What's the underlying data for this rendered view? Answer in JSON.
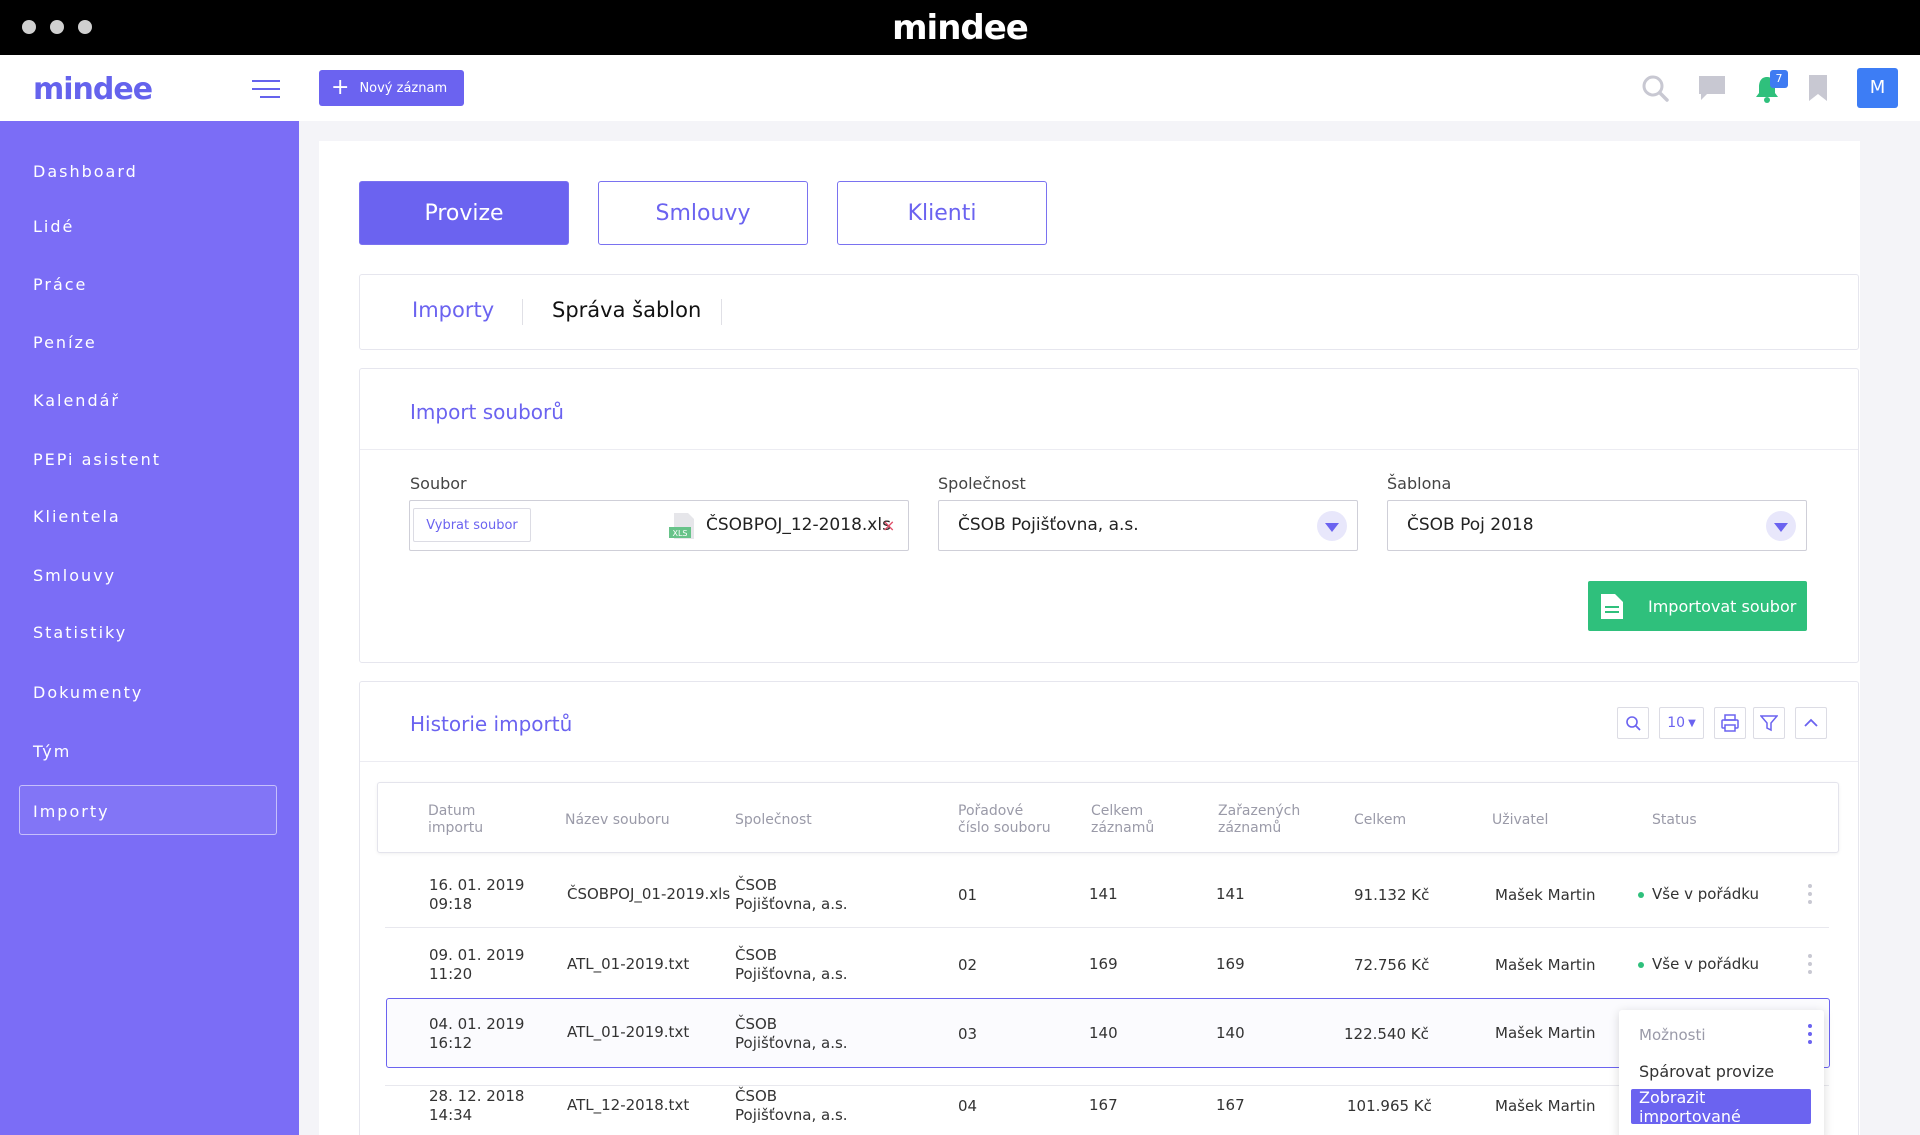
{
  "window": {
    "title": "mindee"
  },
  "sidebar": {
    "logo": "mindee",
    "items": [
      {
        "label": "Dashboard"
      },
      {
        "label": "Lidé"
      },
      {
        "label": "Práce"
      },
      {
        "label": "Peníze"
      },
      {
        "label": "Kalendář"
      },
      {
        "label": "PEPi asistent"
      },
      {
        "label": "Klientela"
      },
      {
        "label": "Smlouvy"
      },
      {
        "label": "Statistiky"
      },
      {
        "label": "Dokumenty"
      },
      {
        "label": "Tým"
      },
      {
        "label": "Importy"
      }
    ],
    "active": "Importy"
  },
  "topbar": {
    "new_button": "Nový záznam",
    "notification_count": "7",
    "avatar_initial": "M"
  },
  "main_tabs": [
    {
      "label": "Provize",
      "active": true
    },
    {
      "label": "Smlouvy",
      "active": false
    },
    {
      "label": "Klienti",
      "active": false
    }
  ],
  "sub_tabs": [
    {
      "label": "Importy",
      "active": true
    },
    {
      "label": "Správa šablon",
      "active": false
    }
  ],
  "import": {
    "title": "Import souborů",
    "file_label": "Soubor",
    "pick_button": "Vybrat soubor",
    "file_name": "ČSOBPOJ_12-2018.xls",
    "file_icon_label": "XLS",
    "remove": "×",
    "company_label": "Společnost",
    "company_value": "ČSOB Pojišťovna, a.s.",
    "template_label": "Šablona",
    "template_value": "ČSOB Poj 2018",
    "import_button": "Importovat soubor"
  },
  "history": {
    "title": "Historie importů",
    "page_size": "10",
    "columns": [
      [
        "Datum",
        "importu"
      ],
      [
        "Název souboru",
        ""
      ],
      [
        "Společnost",
        ""
      ],
      [
        "Pořadové",
        "číslo souboru"
      ],
      [
        "Celkem",
        "záznamů"
      ],
      [
        "Zařazených",
        "záznamů"
      ],
      [
        "Celkem",
        ""
      ],
      [
        "Uživatel",
        ""
      ],
      [
        "Status",
        ""
      ]
    ],
    "rows": [
      {
        "date": "16. 01. 2019",
        "time": "09:18",
        "file": "ČSOBPOJ_01-2019.xls",
        "company1": "ČSOB",
        "company2": "Pojišťovna, a.s.",
        "order": "01",
        "total": "141",
        "assigned": "141",
        "amount": "91.132 Kč",
        "user": "Mašek Martin",
        "status": "Vše v pořádku"
      },
      {
        "date": "09. 01. 2019",
        "time": "11:20",
        "file": "ATL_01-2019.txt",
        "company1": "ČSOB",
        "company2": "Pojišťovna, a.s.",
        "order": "02",
        "total": "169",
        "assigned": "169",
        "amount": "72.756 Kč",
        "user": "Mašek Martin",
        "status": "Vše v pořádku"
      },
      {
        "date": "04. 01. 2019",
        "time": "16:12",
        "file": "ATL_01-2019.txt",
        "company1": "ČSOB",
        "company2": "Pojišťovna, a.s.",
        "order": "03",
        "total": "140",
        "assigned": "140",
        "amount": "122.540 Kč",
        "user": "Mašek Martin",
        "status": ""
      },
      {
        "date": "28. 12. 2018",
        "time": "14:34",
        "file": "ATL_12-2018.txt",
        "company1": "ČSOB",
        "company2": "Pojišťovna, a.s.",
        "order": "04",
        "total": "167",
        "assigned": "167",
        "amount": "101.965 Kč",
        "user": "Mašek Martin",
        "status": ""
      }
    ],
    "menu": {
      "title": "Možnosti",
      "items": [
        "Spárovat provize",
        "Zobrazit importované"
      ]
    }
  },
  "colors": {
    "accent": "#6b63f0",
    "sidebar": "#7b6df6",
    "success": "#2fc07c",
    "avatar": "#3d7df5"
  }
}
